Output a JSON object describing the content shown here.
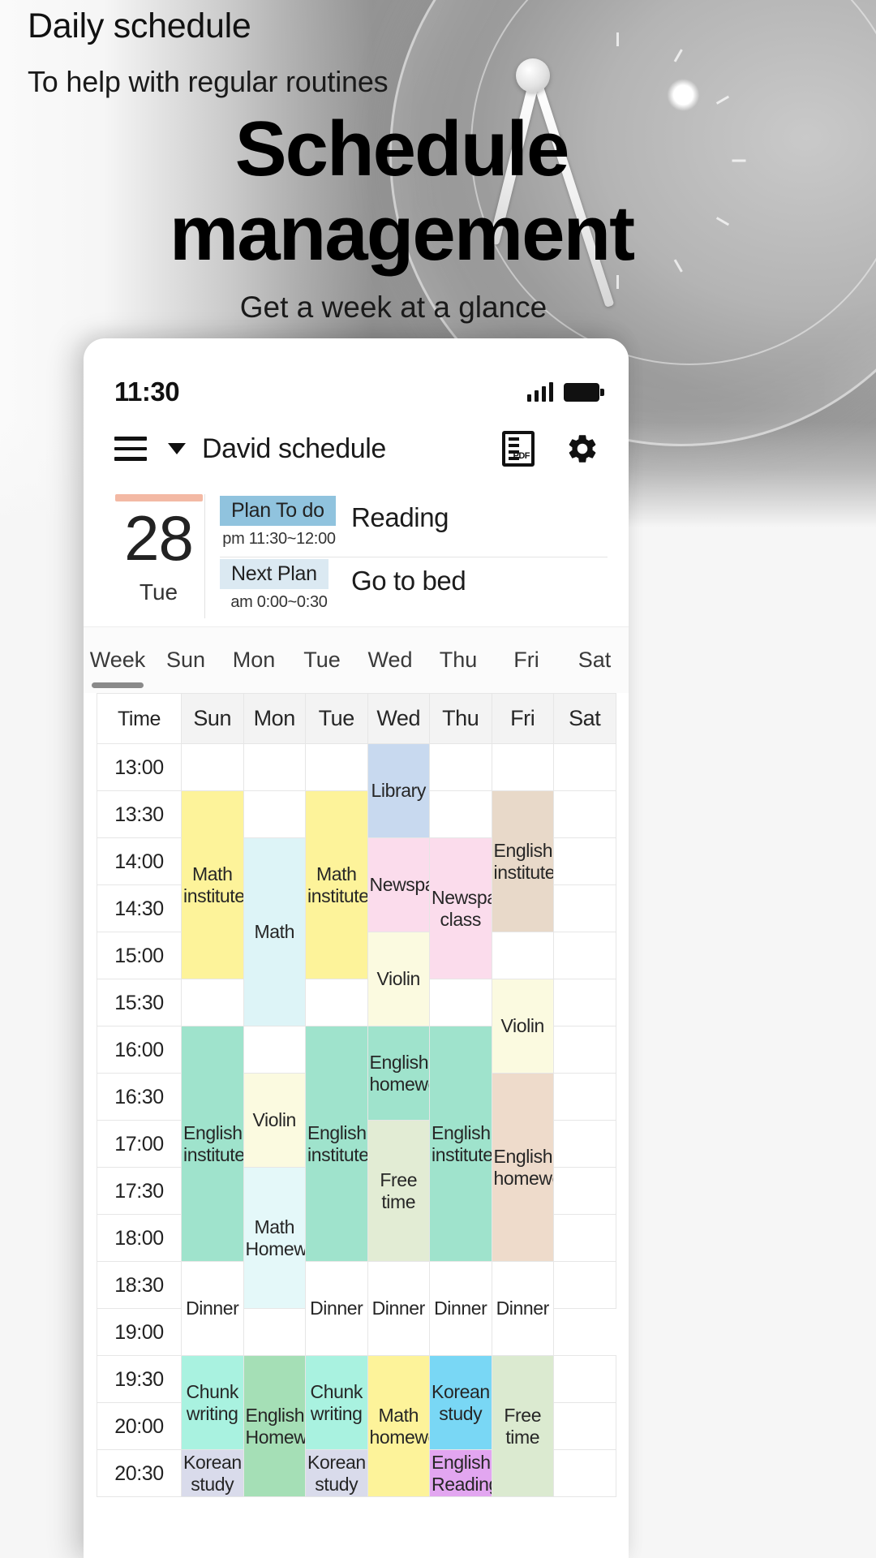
{
  "hero": {
    "kicker": "Daily schedule",
    "subkicker": "To help with regular routines",
    "title_line1": "Schedule",
    "title_line2": "management",
    "tagline": "Get a week at a glance"
  },
  "phone": {
    "status": {
      "time": "11:30",
      "signal_icon": "signal-bars-icon",
      "battery_icon": "battery-full-icon"
    },
    "appbar": {
      "menu_icon": "hamburger-menu-icon",
      "caret_icon": "chevron-down-icon",
      "title": "David schedule",
      "pdf_icon": "pdf-export-icon",
      "pdf_label": "PDF",
      "settings_icon": "gear-icon"
    },
    "today": {
      "date_number": "28",
      "day_of_week": "Tue",
      "accent_color": "#f3b9a4",
      "plans": [
        {
          "chip": "Plan To do",
          "chip_color": "#90c3de",
          "time": "pm 11:30~12:00",
          "name": "Reading"
        },
        {
          "chip": "Next Plan",
          "chip_color": "#dbe9f2",
          "time": "am 0:00~0:30",
          "name": "Go to bed"
        }
      ]
    },
    "week_tabs": {
      "active": "Week",
      "items": [
        "Week",
        "Sun",
        "Mon",
        "Tue",
        "Wed",
        "Thu",
        "Fri",
        "Sat"
      ]
    },
    "table": {
      "headers": [
        "Time",
        "Sun",
        "Mon",
        "Tue",
        "Wed",
        "Thu",
        "Fri",
        "Sat"
      ],
      "times": [
        "13:00",
        "13:30",
        "14:00",
        "14:30",
        "15:00",
        "15:30",
        "16:00",
        "16:30",
        "17:00",
        "17:30",
        "18:00",
        "18:30",
        "19:00",
        "19:30",
        "20:00",
        "20:30"
      ],
      "events": [
        {
          "day": "Sun",
          "start": "13:30",
          "rows": 4,
          "label": "Math institute",
          "color": "#fdf39a"
        },
        {
          "day": "Sun",
          "start": "16:00",
          "rows": 5,
          "label": "English institute",
          "color": "#9fe3cc"
        },
        {
          "day": "Sun",
          "start": "18:30",
          "rows": 2,
          "label": "Dinner",
          "color": "#ffffff"
        },
        {
          "day": "Sun",
          "start": "19:30",
          "rows": 2,
          "label": "Chunk writing",
          "color": "#a9f2e0"
        },
        {
          "day": "Sun",
          "start": "20:30",
          "rows": 2,
          "label": "Korean study",
          "color": "#d9dbeb"
        },
        {
          "day": "Mon",
          "start": "14:00",
          "rows": 4,
          "label": "Math",
          "color": "#ddf4f7"
        },
        {
          "day": "Mon",
          "start": "16:30",
          "rows": 2,
          "label": "Violin",
          "color": "#fbfae0"
        },
        {
          "day": "Mon",
          "start": "17:30",
          "rows": 3,
          "label": "Math Homework",
          "color": "#e4f8f9"
        },
        {
          "day": "Mon",
          "start": "18:30",
          "rows": 2,
          "label": "Dinner",
          "color": "#ffffff"
        },
        {
          "day": "Mon",
          "start": "19:30",
          "rows": 4,
          "label": "English Homework",
          "color": "#a5dfb6"
        },
        {
          "day": "Tue",
          "start": "13:30",
          "rows": 4,
          "label": "Math institute",
          "color": "#fdf39a"
        },
        {
          "day": "Tue",
          "start": "16:00",
          "rows": 5,
          "label": "English institute",
          "color": "#9fe3cc"
        },
        {
          "day": "Tue",
          "start": "18:30",
          "rows": 2,
          "label": "Dinner",
          "color": "#ffffff"
        },
        {
          "day": "Tue",
          "start": "19:30",
          "rows": 2,
          "label": "Chunk writing",
          "color": "#a9f2e0"
        },
        {
          "day": "Tue",
          "start": "20:30",
          "rows": 2,
          "label": "Korean study",
          "color": "#d9dbeb"
        },
        {
          "day": "Wed",
          "start": "13:00",
          "rows": 2,
          "label": "Library",
          "color": "#c8d9ef"
        },
        {
          "day": "Wed",
          "start": "14:00",
          "rows": 2,
          "label": "Newspaper",
          "color": "#fbdcec"
        },
        {
          "day": "Wed",
          "start": "15:00",
          "rows": 2,
          "label": "Violin",
          "color": "#fbfae0"
        },
        {
          "day": "Wed",
          "start": "16:00",
          "rows": 2,
          "label": "English homework",
          "color": "#9fe3cc"
        },
        {
          "day": "Wed",
          "start": "17:00",
          "rows": 3,
          "label": "Free time",
          "color": "#e2ecd4"
        },
        {
          "day": "Wed",
          "start": "18:30",
          "rows": 2,
          "label": "Dinner",
          "color": "#ffffff"
        },
        {
          "day": "Wed",
          "start": "19:30",
          "rows": 4,
          "label": "Math homework",
          "color": "#fdf39a"
        },
        {
          "day": "Thu",
          "start": "14:00",
          "rows": 3,
          "label": "Newspaper class",
          "color": "#fbdcec"
        },
        {
          "day": "Thu",
          "start": "16:00",
          "rows": 5,
          "label": "English institute",
          "color": "#9fe3cc"
        },
        {
          "day": "Thu",
          "start": "18:30",
          "rows": 2,
          "label": "Dinner",
          "color": "#ffffff"
        },
        {
          "day": "Thu",
          "start": "19:30",
          "rows": 2,
          "label": "Korean study",
          "color": "#79d7f5"
        },
        {
          "day": "Thu",
          "start": "20:30",
          "rows": 2,
          "label": "English Reading",
          "color": "#e2a6f0"
        },
        {
          "day": "Fri",
          "start": "13:30",
          "rows": 3,
          "label": "English institute",
          "color": "#e8d9c9"
        },
        {
          "day": "Fri",
          "start": "15:30",
          "rows": 2,
          "label": "Violin",
          "color": "#fbfae0"
        },
        {
          "day": "Fri",
          "start": "16:30",
          "rows": 4,
          "label": "English homework",
          "color": "#eedbcb"
        },
        {
          "day": "Fri",
          "start": "18:30",
          "rows": 2,
          "label": "Dinner",
          "color": "#ffffff"
        },
        {
          "day": "Fri",
          "start": "19:30",
          "rows": 3,
          "label": "Free time",
          "color": "#dbead0"
        }
      ]
    }
  }
}
